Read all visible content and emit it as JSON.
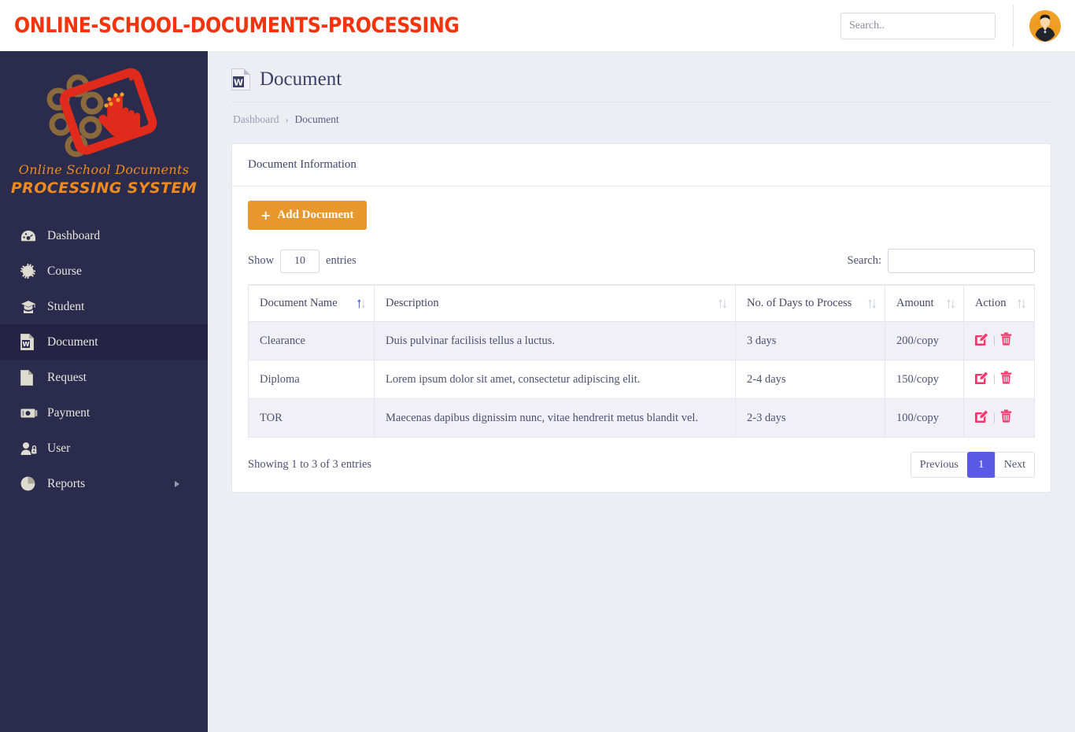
{
  "topbar": {
    "brand_title": "ONLINE-SCHOOL-DOCUMENTS-PROCESSING",
    "search_placeholder": "Search..",
    "search_value": ""
  },
  "sidebar": {
    "logo": {
      "script_text": "Online School Documents",
      "bold_text": "PROCESSING SYSTEM"
    },
    "items": [
      {
        "label": "Dashboard",
        "icon": "gauge-icon",
        "active": false,
        "caret": false
      },
      {
        "label": "Course",
        "icon": "cog-icon",
        "active": false,
        "caret": false
      },
      {
        "label": "Student",
        "icon": "graduate-icon",
        "active": false,
        "caret": false
      },
      {
        "label": "Document",
        "icon": "word-file-icon",
        "active": true,
        "caret": false
      },
      {
        "label": "Request",
        "icon": "file-icon",
        "active": false,
        "caret": false
      },
      {
        "label": "Payment",
        "icon": "money-icon",
        "active": false,
        "caret": false
      },
      {
        "label": "User",
        "icon": "user-lock-icon",
        "active": false,
        "caret": false
      },
      {
        "label": "Reports",
        "icon": "pie-chart-icon",
        "active": false,
        "caret": true
      }
    ]
  },
  "page": {
    "title": "Document",
    "title_icon": "word-file-icon",
    "breadcrumb": {
      "root": "Dashboard",
      "separator": "›",
      "current": "Document"
    }
  },
  "card": {
    "header": "Document Information",
    "add_button": {
      "label": "Add Document",
      "plus": "+"
    }
  },
  "table_controls": {
    "show_label": "Show",
    "entries_value": "10",
    "entries_label": "entries",
    "search_label": "Search:",
    "search_value": "",
    "search_placeholder": ""
  },
  "table": {
    "columns": [
      "Document Name",
      "Description",
      "No. of Days to Process",
      "Amount",
      "Action"
    ],
    "rows": [
      {
        "name": "Clearance",
        "description": "Duis pulvinar facilisis tellus a luctus.",
        "days": "3 days",
        "amount": "200/copy",
        "actions": [
          "edit-icon",
          "delete-icon"
        ]
      },
      {
        "name": "Diploma",
        "description": "Lorem ipsum dolor sit amet, consectetur adipiscing elit.",
        "days": "2-4 days",
        "amount": "150/copy",
        "actions": [
          "edit-icon",
          "delete-icon"
        ]
      },
      {
        "name": "TOR",
        "description": "Maecenas dapibus dignissim nunc, vitae hendrerit metus blandit vel.",
        "days": "2-3 days",
        "amount": "100/copy",
        "actions": [
          "edit-icon",
          "delete-icon"
        ]
      }
    ],
    "action_separator": "|"
  },
  "footer": {
    "showing_info": "Showing 1 to 3 of 3 entries",
    "pagination": {
      "previous": "Previous",
      "pages": [
        "1"
      ],
      "next": "Next",
      "active_page": "1"
    }
  },
  "colors": {
    "brand_red": "#f4340c",
    "sidebar_bg": "#2b2b4d",
    "sidebar_active": "#242344",
    "accent_orange": "#e8972c",
    "action_pink": "#f5376d",
    "pagination_active": "#5a5ae6",
    "content_bg": "#eceef3"
  }
}
